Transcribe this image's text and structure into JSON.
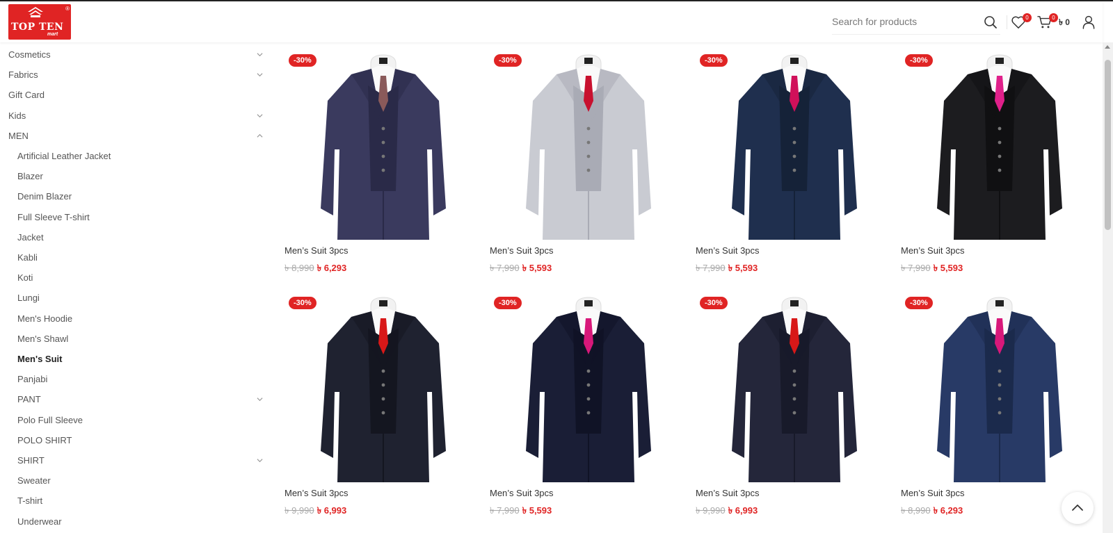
{
  "header": {
    "logo_text": "TOP TEN",
    "logo_sub": "mart",
    "logo_reg": "®",
    "search_placeholder": "Search for products",
    "wishlist_count": "0",
    "cart_count": "0",
    "cart_total": "৳ 0"
  },
  "sidebar": {
    "items": [
      {
        "label": "Cosmetics",
        "sub": false,
        "chevron": "down"
      },
      {
        "label": "Fabrics",
        "sub": false,
        "chevron": "down"
      },
      {
        "label": "Gift Card",
        "sub": false,
        "chevron": ""
      },
      {
        "label": "Kids",
        "sub": false,
        "chevron": "down"
      },
      {
        "label": "MEN",
        "sub": false,
        "chevron": "up"
      },
      {
        "label": "Artificial Leather Jacket",
        "sub": true,
        "chevron": ""
      },
      {
        "label": "Blazer",
        "sub": true,
        "chevron": ""
      },
      {
        "label": "Denim Blazer",
        "sub": true,
        "chevron": ""
      },
      {
        "label": "Full Sleeve T-shirt",
        "sub": true,
        "chevron": ""
      },
      {
        "label": "Jacket",
        "sub": true,
        "chevron": ""
      },
      {
        "label": "Kabli",
        "sub": true,
        "chevron": ""
      },
      {
        "label": "Koti",
        "sub": true,
        "chevron": ""
      },
      {
        "label": "Lungi",
        "sub": true,
        "chevron": ""
      },
      {
        "label": "Men's Hoodie",
        "sub": true,
        "chevron": ""
      },
      {
        "label": "Men's Shawl",
        "sub": true,
        "chevron": ""
      },
      {
        "label": "Men's Suit",
        "sub": true,
        "chevron": "",
        "active": true
      },
      {
        "label": "Panjabi",
        "sub": true,
        "chevron": ""
      },
      {
        "label": "PANT",
        "sub": true,
        "chevron": "down"
      },
      {
        "label": "Polo Full Sleeve",
        "sub": true,
        "chevron": ""
      },
      {
        "label": "POLO SHIRT",
        "sub": true,
        "chevron": ""
      },
      {
        "label": "SHIRT",
        "sub": true,
        "chevron": "down"
      },
      {
        "label": "Sweater",
        "sub": true,
        "chevron": ""
      },
      {
        "label": "T-shirt",
        "sub": true,
        "chevron": ""
      },
      {
        "label": "Underwear",
        "sub": true,
        "chevron": ""
      }
    ]
  },
  "products": [
    {
      "name": "Men’s Suit 3pcs",
      "discount": "-30%",
      "old_price": "৳ 8,990",
      "new_price": "৳ 6,293",
      "suit_color": "#3a3a5e",
      "tie_color": "#8a5a5a",
      "shade": "#2a2a48"
    },
    {
      "name": "Men’s Suit 3pcs",
      "discount": "-30%",
      "old_price": "৳ 7,990",
      "new_price": "৳ 5,593",
      "suit_color": "#c9cbd2",
      "tie_color": "#c8102e",
      "shade": "#a9abb5"
    },
    {
      "name": "Men’s Suit 3pcs",
      "discount": "-30%",
      "old_price": "৳ 7,990",
      "new_price": "৳ 5,593",
      "suit_color": "#1f2f4e",
      "tie_color": "#d0105a",
      "shade": "#152238"
    },
    {
      "name": "Men’s Suit 3pcs",
      "discount": "-30%",
      "old_price": "৳ 7,990",
      "new_price": "৳ 5,593",
      "suit_color": "#1c1c1f",
      "tie_color": "#e0208a",
      "shade": "#101012"
    },
    {
      "name": "Men’s Suit 3pcs",
      "discount": "-30%",
      "old_price": "৳ 9,990",
      "new_price": "৳ 6,993",
      "suit_color": "#1f2230",
      "tie_color": "#d81818",
      "shade": "#141620"
    },
    {
      "name": "Men’s Suit 3pcs",
      "discount": "-30%",
      "old_price": "৳ 7,990",
      "new_price": "৳ 5,593",
      "suit_color": "#1a1e36",
      "tie_color": "#d8187a",
      "shade": "#101326"
    },
    {
      "name": "Men’s Suit 3pcs",
      "discount": "-30%",
      "old_price": "৳ 9,990",
      "new_price": "৳ 6,993",
      "suit_color": "#24263a",
      "tie_color": "#d81818",
      "shade": "#181a2a"
    },
    {
      "name": "Men’s Suit 3pcs",
      "discount": "-30%",
      "old_price": "৳ 8,990",
      "new_price": "৳ 6,293",
      "suit_color": "#283a66",
      "tie_color": "#d8187a",
      "shade": "#1b2a4c"
    }
  ]
}
